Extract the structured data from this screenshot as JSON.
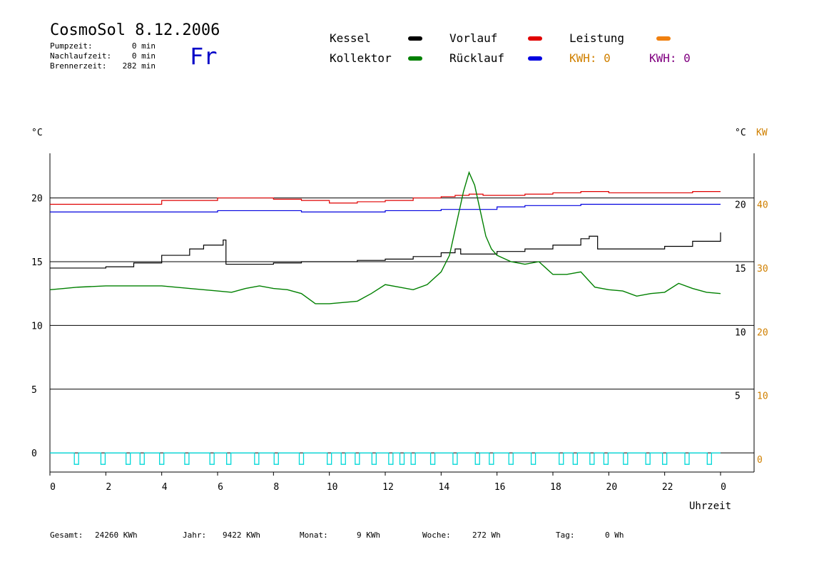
{
  "header": {
    "title": "CosmoSol 8.12.2006",
    "day": "Fr",
    "stats": [
      {
        "label": "Pumpzeit:",
        "value": "0 min"
      },
      {
        "label": "Nachlaufzeit:",
        "value": "0 min"
      },
      {
        "label": "Brennerzeit:",
        "value": "282 min"
      }
    ]
  },
  "legend": {
    "kessel": {
      "label": "Kessel",
      "color": "#000000"
    },
    "kollektor": {
      "label": "Kollektor",
      "color": "#008000"
    },
    "vorlauf": {
      "label": "Vorlauf",
      "color": "#e00000"
    },
    "ruecklauf": {
      "label": "Rücklauf",
      "color": "#0000e0"
    },
    "leistung": {
      "label": "Leistung",
      "color": "#f08010"
    },
    "kwh_orange": "KWH: 0",
    "kwh_purple": "KWH: 0",
    "kwh_purple_color": "#800080",
    "kwh_orange_color": "#d08000"
  },
  "footer": [
    {
      "label": "Gesamt:",
      "value": "24260 KWh"
    },
    {
      "label": "Jahr:",
      "value": "9422 KWh"
    },
    {
      "label": "Monat:",
      "value": "9 KWh"
    },
    {
      "label": "Woche:",
      "value": "272 Wh"
    },
    {
      "label": "Tag:",
      "value": "0 Wh"
    }
  ],
  "chart_data": {
    "type": "line",
    "xlabel": "Uhrzeit",
    "ylabel_left": "°C",
    "ylabel_right": "°C",
    "ylabel_right2": "KW",
    "xlim": [
      0,
      24
    ],
    "ylim_left": [
      -1.5,
      23.5
    ],
    "ylim_right": [
      -1,
      24
    ],
    "ylim_kw": [
      -2,
      48
    ],
    "x_ticks": [
      0,
      2,
      4,
      6,
      8,
      10,
      12,
      14,
      16,
      18,
      20,
      22,
      24
    ],
    "x_tick_labels": [
      "0",
      "2",
      "4",
      "6",
      "8",
      "10",
      "12",
      "14",
      "16",
      "18",
      "20",
      "22",
      "0"
    ],
    "y_left_ticks": [
      0,
      5,
      10,
      15,
      20
    ],
    "y_left_tick_labels": [
      "0",
      "5",
      "10",
      "15",
      "20"
    ],
    "y_right_ticks": [
      5,
      10,
      15,
      20
    ],
    "y_right_tick_labels": [
      "5",
      "10",
      "15",
      "20"
    ],
    "y_kw_ticks": [
      0,
      10,
      20,
      30,
      40
    ],
    "y_kw_tick_labels": [
      "0",
      "10",
      "20",
      "30",
      "40"
    ],
    "gridlines_left": [
      0,
      5,
      10,
      15,
      20
    ],
    "grid": true,
    "series": [
      {
        "key": "vorlauf",
        "color": "#e00000",
        "x": [
          0,
          2,
          4,
          6,
          7,
          8,
          9,
          10,
          11,
          12,
          13,
          14,
          14.5,
          15,
          15.5,
          16,
          17,
          18,
          19,
          20,
          21,
          22,
          23,
          24
        ],
        "values": [
          19.5,
          19.5,
          19.8,
          20.0,
          20.0,
          19.9,
          19.8,
          19.6,
          19.7,
          19.8,
          20.0,
          20.1,
          20.2,
          20.3,
          20.2,
          20.2,
          20.3,
          20.4,
          20.5,
          20.4,
          20.4,
          20.4,
          20.5,
          20.5
        ]
      },
      {
        "key": "ruecklauf",
        "color": "#0000e0",
        "x": [
          0,
          2,
          4,
          6,
          7,
          8,
          9,
          10,
          11,
          12,
          13,
          14,
          15,
          16,
          17,
          18,
          19,
          20,
          21,
          22,
          23,
          24
        ],
        "values": [
          18.9,
          18.9,
          18.9,
          19.0,
          19.0,
          19.0,
          18.9,
          18.9,
          18.9,
          19.0,
          19.0,
          19.1,
          19.1,
          19.3,
          19.4,
          19.4,
          19.5,
          19.5,
          19.5,
          19.5,
          19.5,
          19.5
        ]
      },
      {
        "key": "kessel",
        "color": "#000000",
        "x": [
          0,
          1,
          2,
          3,
          4,
          5,
          5.5,
          6.2,
          6.3,
          7,
          8,
          9,
          10,
          11,
          12,
          13,
          14,
          14.5,
          14.7,
          15,
          16,
          17,
          18,
          19,
          19.3,
          19.6,
          20,
          21,
          22,
          23,
          24
        ],
        "values": [
          14.5,
          14.5,
          14.6,
          14.9,
          15.5,
          16.0,
          16.3,
          16.7,
          14.8,
          14.8,
          14.9,
          15.0,
          15.0,
          15.1,
          15.2,
          15.4,
          15.7,
          16.0,
          15.6,
          15.6,
          15.8,
          16.0,
          16.3,
          16.8,
          17.0,
          16.0,
          16.0,
          16.0,
          16.2,
          16.6,
          17.3
        ]
      },
      {
        "key": "kollektor",
        "color": "#008000",
        "x": [
          0,
          0.5,
          1,
          2,
          3,
          4,
          5,
          6,
          6.5,
          7,
          7.5,
          8,
          8.5,
          9,
          9.5,
          10,
          11,
          11.5,
          12,
          12.5,
          13,
          13.5,
          14,
          14.3,
          14.6,
          14.8,
          15,
          15.2,
          15.4,
          15.6,
          15.8,
          16,
          16.5,
          17,
          17.5,
          18,
          18.5,
          19,
          19.5,
          20,
          20.5,
          21,
          21.5,
          22,
          22.5,
          23,
          23.5,
          24
        ],
        "values": [
          12.8,
          12.9,
          13.0,
          13.1,
          13.1,
          13.1,
          12.9,
          12.7,
          12.6,
          12.9,
          13.1,
          12.9,
          12.8,
          12.5,
          11.7,
          11.7,
          11.9,
          12.5,
          13.2,
          13.0,
          12.8,
          13.2,
          14.2,
          15.5,
          18.5,
          20.5,
          22.0,
          21.0,
          19.0,
          17.0,
          16.0,
          15.5,
          15.0,
          14.8,
          15.0,
          14.0,
          14.0,
          14.2,
          13.0,
          12.8,
          12.7,
          12.3,
          12.5,
          12.6,
          13.3,
          12.9,
          12.6,
          12.5
        ]
      }
    ],
    "pump_events": [
      0.95,
      1.9,
      2.8,
      3.3,
      4.0,
      4.9,
      5.8,
      6.4,
      7.4,
      8.1,
      9.0,
      10.0,
      10.5,
      11.0,
      11.6,
      12.2,
      12.6,
      13.0,
      13.7,
      14.5,
      15.3,
      15.8,
      16.5,
      17.3,
      18.3,
      18.8,
      19.4,
      19.9,
      20.6,
      21.4,
      22.0,
      22.8,
      23.6
    ]
  }
}
